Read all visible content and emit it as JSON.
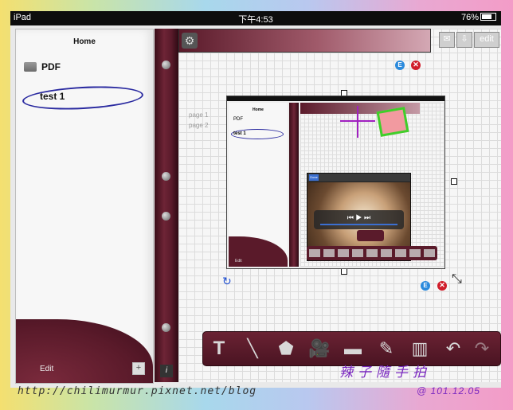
{
  "status": {
    "device": "iPad",
    "time": "下午4:53",
    "battery": "76%"
  },
  "sidebar": {
    "title": "Home",
    "items": [
      {
        "label": "PDF"
      },
      {
        "label": "test 1"
      }
    ],
    "edit_label": "Edit",
    "add_label": "+"
  },
  "spine": {
    "info_label": "i"
  },
  "canvas": {
    "edit_label": "edit",
    "pages": [
      {
        "label": "page 1"
      },
      {
        "label": "page 2"
      }
    ],
    "badge_e": "E",
    "badge_x": "✕"
  },
  "inner": {
    "title": "Home",
    "pdf": "PDF",
    "test": "test 1",
    "edit": "Edit",
    "video_done": "Done"
  },
  "video": {
    "controls": "⏮  ▶  ⏭"
  },
  "toolbar": {
    "text_tool": "T"
  },
  "footer": {
    "url": "http://chilimurmur.pixnet.net/blog",
    "signature": "辣子隨手拍",
    "date": "@ 101.12.05"
  },
  "colors": {
    "leather": "#5a1b2b",
    "accent_blue": "#2b8adc",
    "delete_red": "#d01d2a",
    "ink_purple": "#7a28c0"
  }
}
